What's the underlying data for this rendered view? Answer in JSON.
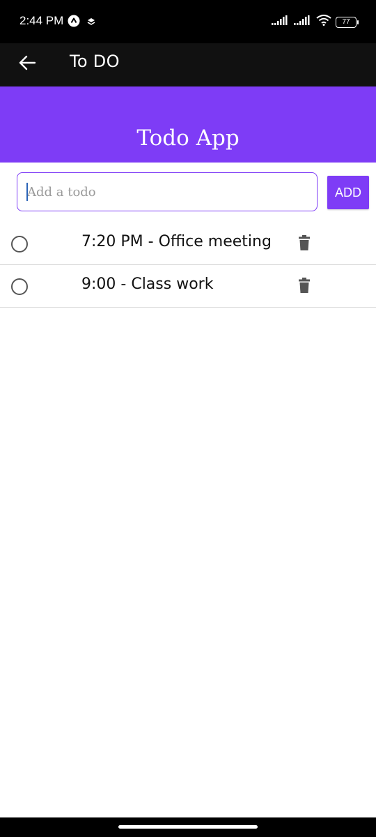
{
  "status_bar": {
    "time": "2:44 PM",
    "battery": "77",
    "icons": [
      "app-notification-icon",
      "layers-icon",
      "signal-icon",
      "signal-icon",
      "wifi-icon",
      "battery-icon"
    ]
  },
  "app_bar": {
    "back_icon": "arrow-left-icon",
    "title": "To DO"
  },
  "header": {
    "title": "Todo App",
    "color": "#7e3cf6"
  },
  "input": {
    "placeholder": "Add a todo",
    "value": ""
  },
  "add_button": {
    "label": "ADD"
  },
  "todos": [
    {
      "text": "7:20 PM - Office meeting",
      "completed": false
    },
    {
      "text": "9:00 - Class work",
      "completed": false
    }
  ],
  "colors": {
    "accent": "#7e3cf6",
    "status_bar": "#000000",
    "app_bar": "#111111"
  }
}
